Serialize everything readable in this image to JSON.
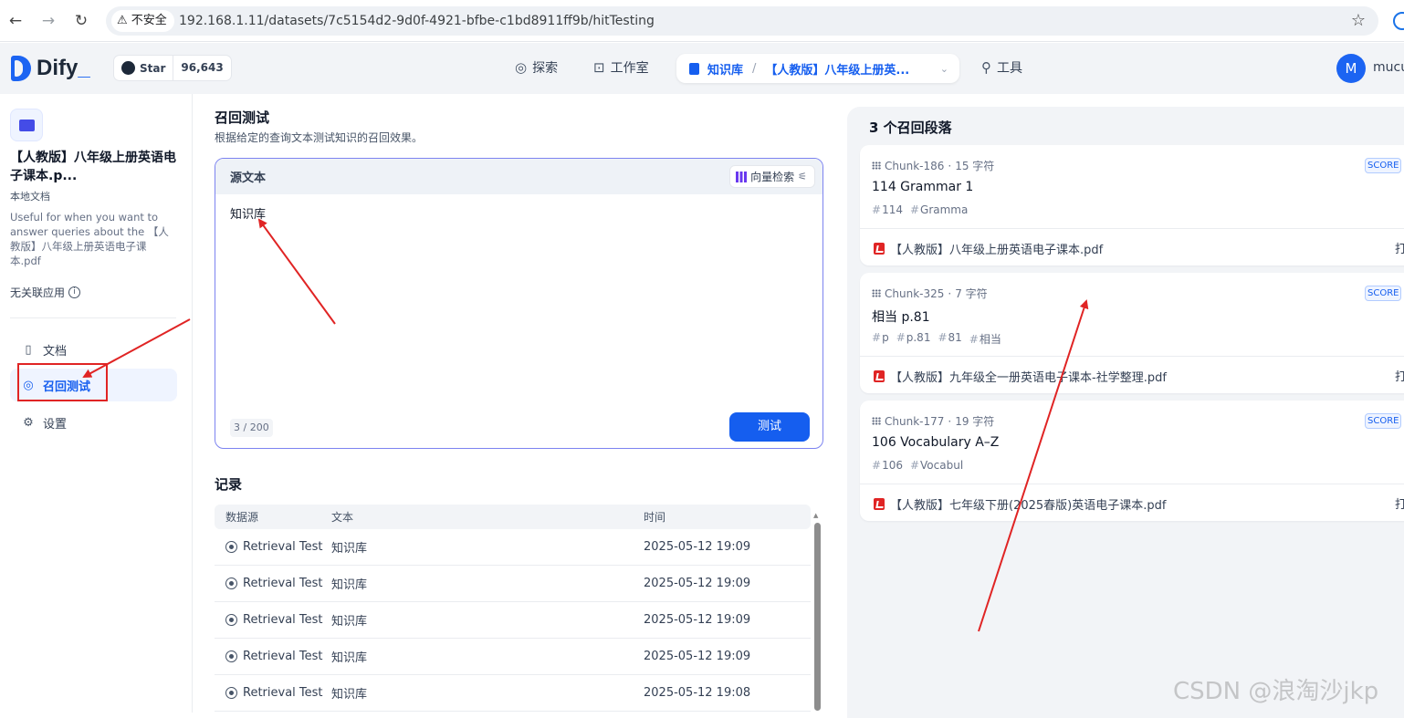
{
  "browser": {
    "security_label": "不安全",
    "url": "192.168.1.11/datasets/7c5154d2-9d0f-4921-bfbe-c1bd8911ff9b/hitTesting"
  },
  "header": {
    "logo_text": "Dify",
    "github_star_label": "Star",
    "github_star_count": "96,643",
    "nav": {
      "explore": "探索",
      "studio": "工作室",
      "knowledge": "知识库",
      "current_dataset": "【人教版】八年级上册英...",
      "tools": "工具"
    },
    "avatar_initial": "M",
    "username": "mucu"
  },
  "sidebar": {
    "dataset_name": "【人教版】八年级上册英语电子课本.p...",
    "dataset_type": "本地文档",
    "dataset_description": "Useful for when you want to answer queries about the 【人教版】八年级上册英语电子课本.pdf",
    "unlinked_apps": "无关联应用",
    "items": [
      {
        "label": "文档",
        "icon": "document-icon"
      },
      {
        "label": "召回测试",
        "icon": "target-icon"
      },
      {
        "label": "设置",
        "icon": "gear-icon"
      }
    ]
  },
  "retrieval": {
    "title": "召回测试",
    "subtitle": "根据给定的查询文本测试知识的召回效果。",
    "source_label": "源文本",
    "method_label": "向量检索",
    "query_text": "知识库",
    "char_count": "3",
    "char_limit": "200",
    "test_button": "测试"
  },
  "records": {
    "title": "记录",
    "columns": [
      "数据源",
      "文本",
      "时间"
    ],
    "rows": [
      {
        "source": "Retrieval Test",
        "text": "知识库",
        "time": "2025-05-12 19:09"
      },
      {
        "source": "Retrieval Test",
        "text": "知识库",
        "time": "2025-05-12 19:09"
      },
      {
        "source": "Retrieval Test",
        "text": "知识库",
        "time": "2025-05-12 19:09"
      },
      {
        "source": "Retrieval Test",
        "text": "知识库",
        "time": "2025-05-12 19:09"
      },
      {
        "source": "Retrieval Test",
        "text": "知识库",
        "time": "2025-05-12 19:08"
      }
    ]
  },
  "results": {
    "title": "3 个召回段落",
    "score_label": "SCORE",
    "open_label": "打",
    "chunks": [
      {
        "id": "Chunk-186",
        "chars": "15 字符",
        "content": "114 Grammar 1",
        "tags": [
          "114",
          "Gramma"
        ],
        "file": "【人教版】八年级上册英语电子课本.pdf"
      },
      {
        "id": "Chunk-325",
        "chars": "7 字符",
        "content": "相当 p.81",
        "tags": [
          "p",
          "p.81",
          "81",
          "相当"
        ],
        "file": "【人教版】九年级全一册英语电子课本-社学整理.pdf"
      },
      {
        "id": "Chunk-177",
        "chars": "19 字符",
        "content": "106 Vocabulary A–Z",
        "tags": [
          "106",
          "Vocabul"
        ],
        "file": "【人教版】七年级下册(2025春版)英语电子课本.pdf"
      }
    ]
  },
  "watermark": "CSDN @浪淘沙jkp",
  "colors": {
    "primary": "#155eef",
    "annotation_red": "#e02424",
    "panel_bg": "#f2f4f7"
  }
}
